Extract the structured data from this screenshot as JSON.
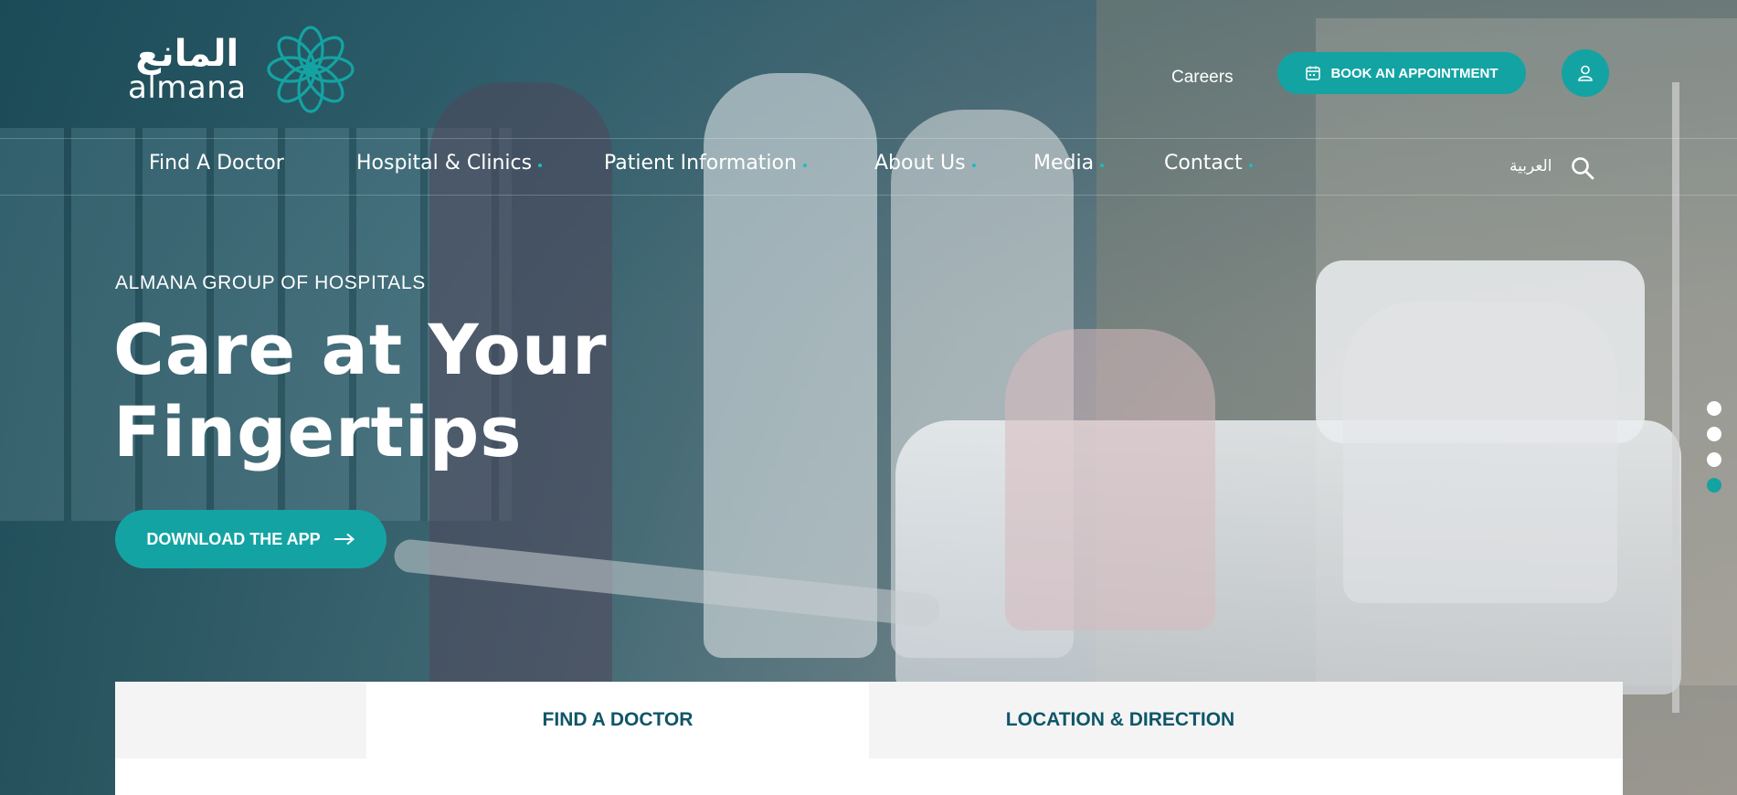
{
  "brand": {
    "logo_arabic": "المانع",
    "logo_english": "almana",
    "accent_color": "#14a3a3",
    "dark_text_color": "#0f5667",
    "logo_icon": "flower-emblem-icon"
  },
  "header": {
    "careers_label": "Careers",
    "book_label": "BOOK AN APPOINTMENT",
    "book_icon": "calendar-icon",
    "user_icon": "user-icon"
  },
  "nav": {
    "items": [
      {
        "label": "Find A Doctor",
        "has_dropdown": false
      },
      {
        "label": "Hospital & Clinics",
        "has_dropdown": true
      },
      {
        "label": "Patient Information",
        "has_dropdown": true
      },
      {
        "label": "About Us",
        "has_dropdown": true
      },
      {
        "label": "Media",
        "has_dropdown": true
      },
      {
        "label": "Contact",
        "has_dropdown": true
      }
    ],
    "language_label": "العربية",
    "search_icon": "search-icon"
  },
  "hero": {
    "eyebrow": "ALMANA GROUP OF HOSPITALS",
    "headline_line1": "Care at Your",
    "headline_line2": "Fingertips",
    "cta_label": "DOWNLOAD THE APP",
    "cta_icon": "arrow-right-icon",
    "slide_count": 4,
    "active_slide": 4
  },
  "tabs": {
    "items": [
      "FIND A DOCTOR",
      "LOCATION & DIRECTION"
    ],
    "active_index": 0
  }
}
